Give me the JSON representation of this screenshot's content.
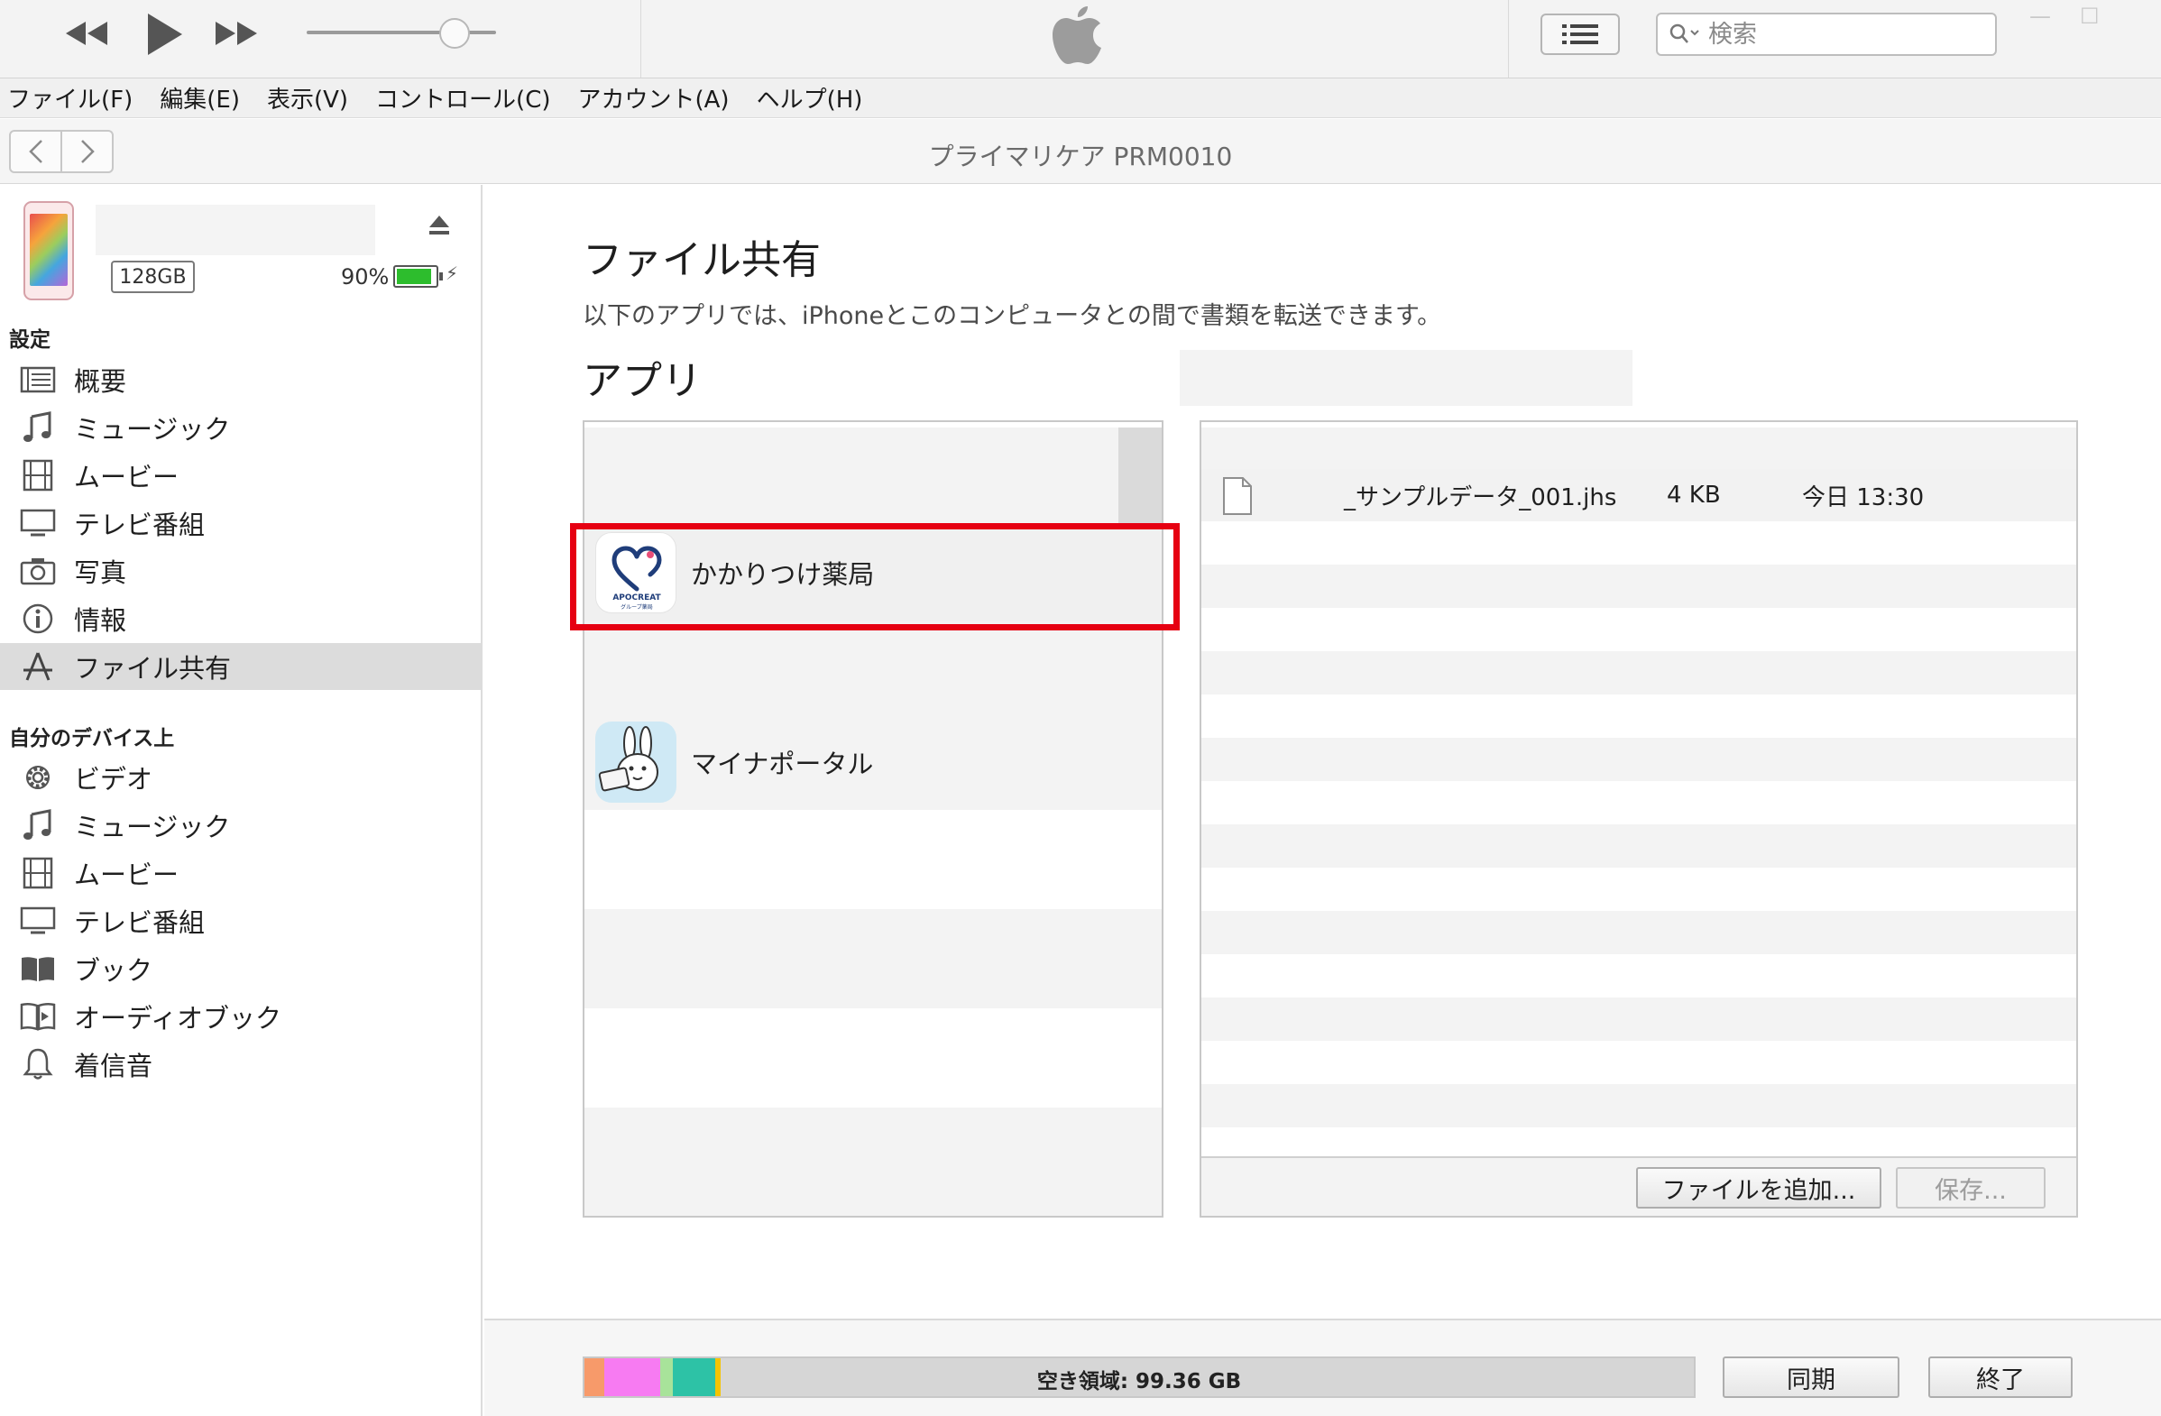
{
  "app": {
    "window_title": "プライマリケア PRM0010"
  },
  "toolbar": {
    "search_placeholder": "検索",
    "volume_level": 0.78
  },
  "menu": [
    "ファイル(F)",
    "編集(E)",
    "表示(V)",
    "コントロール(C)",
    "アカウント(A)",
    "ヘルプ(H)"
  ],
  "device": {
    "capacity": "128GB",
    "battery_percent": "90%",
    "battery_level": 0.9
  },
  "sidebar": {
    "settings_heading": "設定",
    "settings_items": [
      {
        "label": "概要",
        "icon": "summary-icon"
      },
      {
        "label": "ミュージック",
        "icon": "music-note-icon"
      },
      {
        "label": "ムービー",
        "icon": "film-icon"
      },
      {
        "label": "テレビ番組",
        "icon": "tv-icon"
      },
      {
        "label": "写真",
        "icon": "camera-icon"
      },
      {
        "label": "情報",
        "icon": "info-icon"
      },
      {
        "label": "ファイル共有",
        "icon": "app-store-icon",
        "selected": true
      }
    ],
    "on_device_heading": "自分のデバイス上",
    "on_device_items": [
      {
        "label": "ビデオ",
        "icon": "gear-icon"
      },
      {
        "label": "ミュージック",
        "icon": "music-note-icon"
      },
      {
        "label": "ムービー",
        "icon": "film-icon"
      },
      {
        "label": "テレビ番組",
        "icon": "tv-icon"
      },
      {
        "label": "ブック",
        "icon": "book-icon"
      },
      {
        "label": "オーディオブック",
        "icon": "audiobook-icon"
      },
      {
        "label": "着信音",
        "icon": "bell-icon"
      }
    ]
  },
  "main": {
    "title": "ファイル共有",
    "description": "以下のアプリでは、iPhoneとこのコンピュータとの間で書類を転送できます。",
    "apps_heading": "アプリ",
    "apps": [
      {
        "name": "かかりつけ薬局",
        "icon": "apocreat-pharmacy-icon",
        "icon_text": "APOCREAT",
        "icon_subtext": "グループ薬局",
        "highlighted": true
      },
      {
        "name": "マイナポータル",
        "icon": "myna-rabbit-icon"
      }
    ],
    "files": [
      {
        "name": "_サンプルデータ_001.jhs",
        "size": "4 KB",
        "date": "今日 13:30",
        "icon": "document-icon"
      }
    ],
    "add_file_button": "ファイルを追加...",
    "save_button": "保存..."
  },
  "bottom": {
    "storage_label": "空き領域: 99.36 GB",
    "storage_segments": [
      {
        "color": "#f79a6a",
        "fraction": 0.018
      },
      {
        "color": "#f77bf2",
        "fraction": 0.05
      },
      {
        "color": "#a8e39a",
        "fraction": 0.012
      },
      {
        "color": "#2dc2a6",
        "fraction": 0.038
      },
      {
        "color": "#f5c400",
        "fraction": 0.005
      }
    ],
    "sync_button": "同期",
    "done_button": "終了"
  },
  "colors": {
    "highlight": "#e60012",
    "selected_row": "#dcdcdc",
    "battery": "#2dbd2d"
  }
}
